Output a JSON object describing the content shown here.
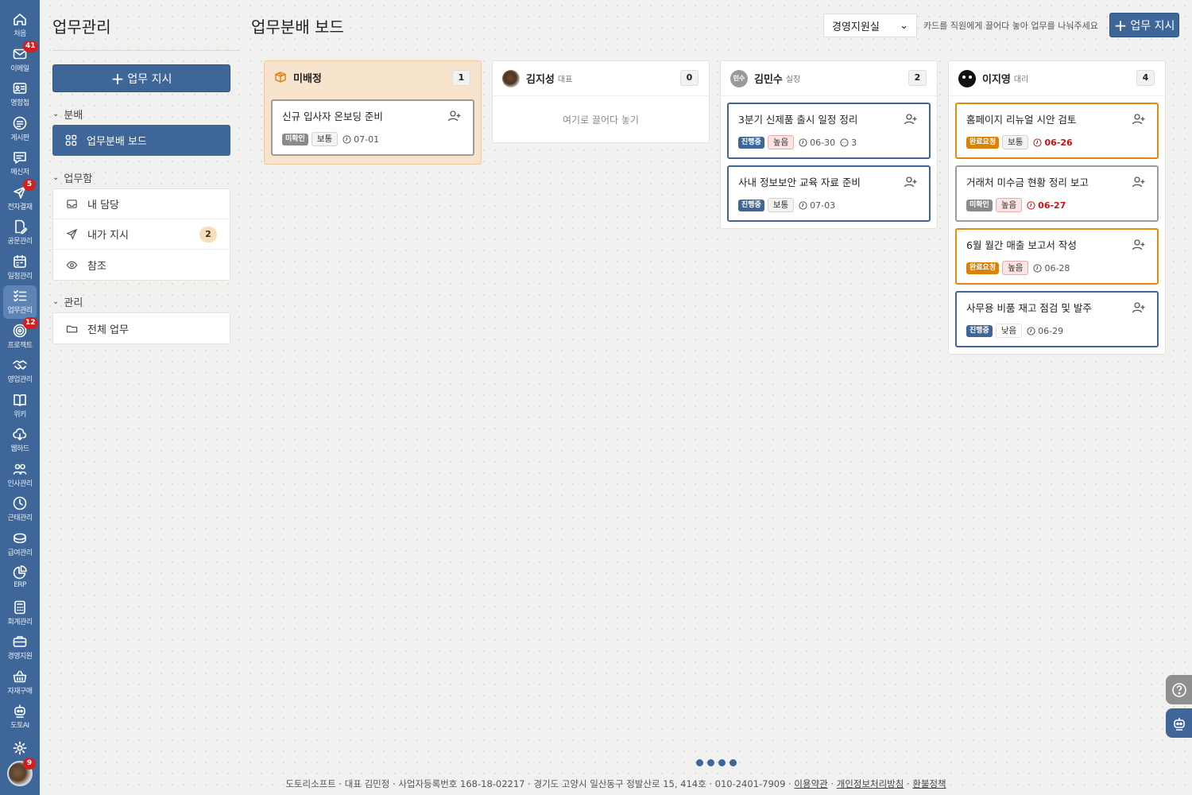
{
  "rail": {
    "items": [
      {
        "label": "처음",
        "icon": "home-icon"
      },
      {
        "label": "이메일",
        "icon": "mail-icon",
        "badge": "41"
      },
      {
        "label": "명함첩",
        "icon": "card-icon"
      },
      {
        "label": "게시판",
        "icon": "board-icon"
      },
      {
        "label": "메신저",
        "icon": "chat-icon"
      },
      {
        "label": "전자결재",
        "icon": "send-icon",
        "badge": "5"
      },
      {
        "label": "공문관리",
        "icon": "doc-edit-icon"
      },
      {
        "label": "일정관리",
        "icon": "calendar-icon"
      },
      {
        "label": "업무관리",
        "icon": "checklist-icon",
        "active": true
      },
      {
        "label": "프로젝트",
        "icon": "target-icon",
        "badge": "12"
      },
      {
        "label": "영업관리",
        "icon": "handshake-icon"
      },
      {
        "label": "위키",
        "icon": "book-icon"
      },
      {
        "label": "웹하드",
        "icon": "cloud-icon"
      },
      {
        "label": "인사관리",
        "icon": "people-icon"
      },
      {
        "label": "근태관리",
        "icon": "clock-icon"
      },
      {
        "label": "급여관리",
        "icon": "coins-icon"
      },
      {
        "label": "ERP",
        "icon": "chart-pie-icon"
      },
      {
        "label": "회계관리",
        "icon": "calculator-icon"
      },
      {
        "label": "경영지원",
        "icon": "briefcase-icon"
      },
      {
        "label": "자재구매",
        "icon": "basket-icon"
      },
      {
        "label": "도토AI",
        "icon": "robot-icon"
      }
    ],
    "settings_icon": "gear-icon",
    "profile_badge": "9"
  },
  "sidebar": {
    "title": "업무관리",
    "new_task_button": "업무 지시",
    "section_distribute": "분배",
    "board_label": "업무분배 보드",
    "section_inbox": "업무함",
    "inbox_items": [
      {
        "label": "내 담당",
        "icon": "inbox-icon"
      },
      {
        "label": "내가 지시",
        "icon": "send-icon",
        "count": "2"
      },
      {
        "label": "참조",
        "icon": "eye-icon"
      }
    ],
    "section_manage": "관리",
    "manage_items": [
      {
        "label": "전체 업무",
        "icon": "folder-icon"
      }
    ]
  },
  "header": {
    "title": "업무분배 보드",
    "department": "경영지원실",
    "hint": "카드를 직원에게 끌어다 놓아 업무를 나눠주세요",
    "new_task_button": "업무 지시"
  },
  "columns": [
    {
      "name": "미배정",
      "rank": "",
      "count": "1",
      "avatar": "box-icon",
      "cards": [
        {
          "title": "신규 입사자 온보딩 준비",
          "status": "미확인",
          "status_color": "gray",
          "priority": "보통",
          "priority_level": "normal",
          "due": "07-01",
          "overdue": false
        }
      ]
    },
    {
      "name": "김지성",
      "rank": "대표",
      "count": "0",
      "avatar": "photo-avatar",
      "drop_hint": "여기로 끌어다 놓기",
      "cards": []
    },
    {
      "name": "김민수",
      "rank": "실장",
      "count": "2",
      "avatar": "initials-avatar",
      "initials": "민수",
      "cards": [
        {
          "title": "3분기 신제품 출시 일정 정리",
          "status": "진행중",
          "status_color": "blue",
          "priority": "높음",
          "priority_level": "high",
          "due": "06-30",
          "overdue": false,
          "comments": "3"
        },
        {
          "title": "사내 정보보안 교육 자료 준비",
          "status": "진행중",
          "status_color": "blue",
          "priority": "보통",
          "priority_level": "normal",
          "due": "07-03",
          "overdue": false
        }
      ]
    },
    {
      "name": "이지영",
      "rank": "대리",
      "count": "4",
      "avatar": "cat-avatar",
      "cards": [
        {
          "title": "홈페이지 리뉴얼 시안 검토",
          "status": "완료요청",
          "status_color": "orange",
          "priority": "보통",
          "priority_level": "normal",
          "due": "06-26",
          "overdue": true
        },
        {
          "title": "거래처 미수금 현황 정리 보고",
          "status": "미확인",
          "status_color": "gray",
          "priority": "높음",
          "priority_level": "high",
          "due": "06-27",
          "overdue": true
        },
        {
          "title": "6월 월간 매출 보고서 작성",
          "status": "완료요청",
          "status_color": "orange",
          "priority": "높음",
          "priority_level": "high",
          "due": "06-28",
          "overdue": false
        },
        {
          "title": "사무용 비품 재고 점검 및 발주",
          "status": "진행중",
          "status_color": "blue",
          "priority": "낮음",
          "priority_level": "low",
          "due": "06-29",
          "overdue": false
        }
      ]
    }
  ],
  "footer": {
    "company": "도토리소프트 · 대표 김민정 · 사업자등록번호 168-18-02217 · 경기도 고양시 일산동구 정발산로 15, 414호 · 010-2401-7909",
    "links": [
      "이용약관",
      "개인정보처리방침",
      "환불정책"
    ]
  },
  "colors": {
    "brand": "#3e6698",
    "orange": "#e08a12",
    "danger": "#d21f1f"
  }
}
